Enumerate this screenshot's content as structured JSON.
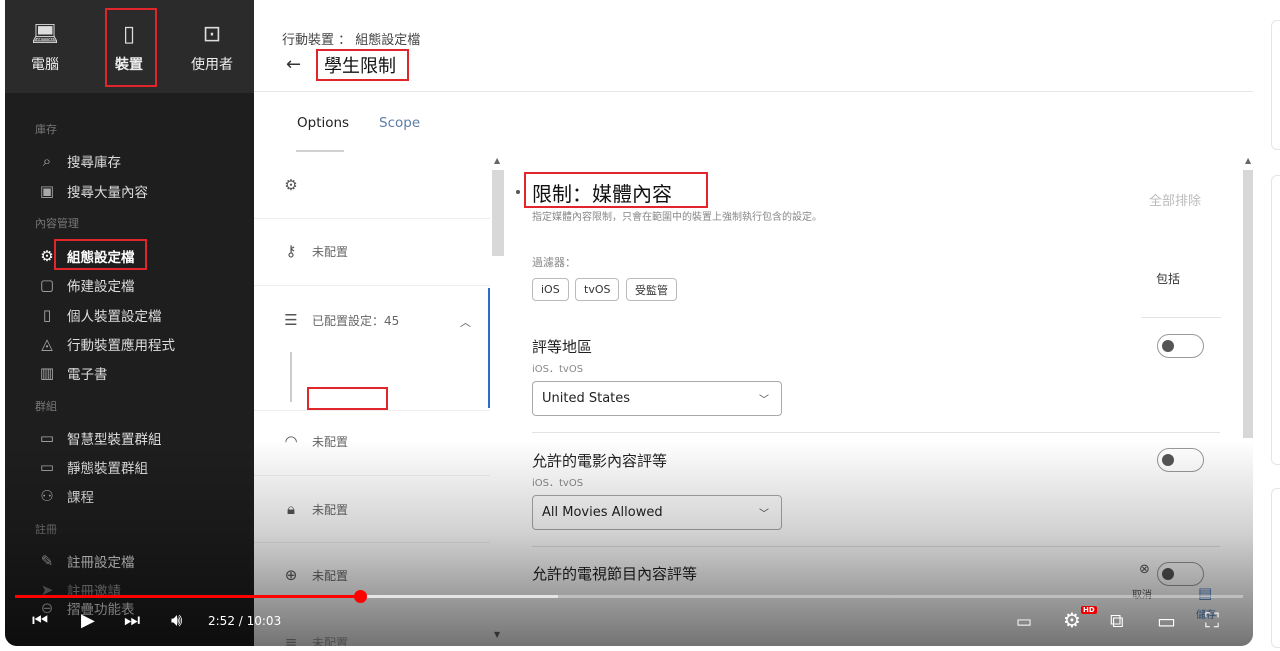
{
  "sidebar": {
    "nav": [
      {
        "label": "電腦",
        "icon": "laptop-icon"
      },
      {
        "label": "裝置",
        "icon": "mobile-device-icon",
        "active": true
      },
      {
        "label": "使用者",
        "icon": "user-icon"
      }
    ],
    "sections": {
      "inventory": "庫存",
      "content": "內容管理",
      "groups": "群組",
      "enroll": "註冊"
    },
    "items": {
      "search_inventory": "搜尋庫存",
      "search_bulk": "搜尋大量內容",
      "config_profiles": "組態設定檔",
      "provisioning": "佈建設定檔",
      "personal_profiles": "個人裝置設定檔",
      "mobile_apps": "行動裝置應用程式",
      "ebooks": "電子書",
      "smart_groups": "智慧型裝置群組",
      "static_groups": "靜態裝置群組",
      "classes": "課程",
      "enroll_profiles": "註冊設定檔",
      "enroll_invites": "註冊邀請",
      "collapse_menu": "摺疊功能表"
    }
  },
  "header": {
    "breadcrumb": "行動裝置 ： 組態設定檔",
    "back_arrow": "←",
    "title": "學生限制"
  },
  "tabs": [
    {
      "label": "Options",
      "active": true
    },
    {
      "label": "Scope",
      "active": false
    }
  ],
  "payloads": {
    "general_icon": "gear-icon",
    "passcode": "未配置",
    "restrictions": "已配置設定：45",
    "wifi": "未配置",
    "vpn": "未配置",
    "web": "未配置",
    "next": "未配置"
  },
  "section": {
    "title": "限制：媒體內容",
    "description": "指定媒體內容限制，只會在範圍中的裝置上強制執行包含的設定。",
    "exclude_all": "全部排除",
    "filter_label": "過濾器：",
    "filters": [
      "iOS",
      "tvOS",
      "受監管"
    ],
    "include_header": "包括"
  },
  "settings": [
    {
      "title": "評等地區",
      "platforms": "iOS．tvOS",
      "value": "United States",
      "enabled": false
    },
    {
      "title": "允許的電影內容評等",
      "platforms": "iOS．tvOS",
      "value": "All Movies Allowed",
      "enabled": false
    },
    {
      "title": "允許的電視節目內容評等",
      "platforms": "",
      "value": "",
      "enabled": false
    }
  ],
  "player": {
    "time": "2:52 / 10:03",
    "progress": 0.281,
    "buffered": 0.442,
    "hd_badge": "HD",
    "cancel": "取消",
    "save": "儲存"
  },
  "colors": {
    "sidebar_bg": "#1e1e1e",
    "highlight_box": "#e0262b",
    "accent_blue": "#2c6bc7",
    "progress_red": "#ff0000"
  }
}
